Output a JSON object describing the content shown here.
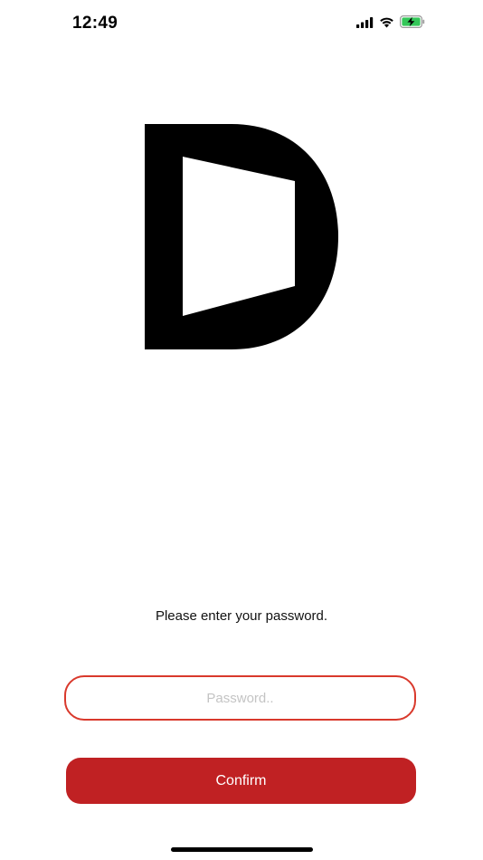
{
  "status_bar": {
    "time": "12:49",
    "icons": [
      "cellular-signal-icon",
      "wifi-icon",
      "battery-charging-icon"
    ],
    "battery_color": "#34c759"
  },
  "logo": {
    "icon": "d-logo-icon",
    "color": "#000000"
  },
  "login": {
    "prompt": "Please enter your password.",
    "password_placeholder": "Password..",
    "password_value": "",
    "confirm_label": "Confirm"
  },
  "colors": {
    "accent": "#c02123",
    "field_border": "#d9392c"
  }
}
